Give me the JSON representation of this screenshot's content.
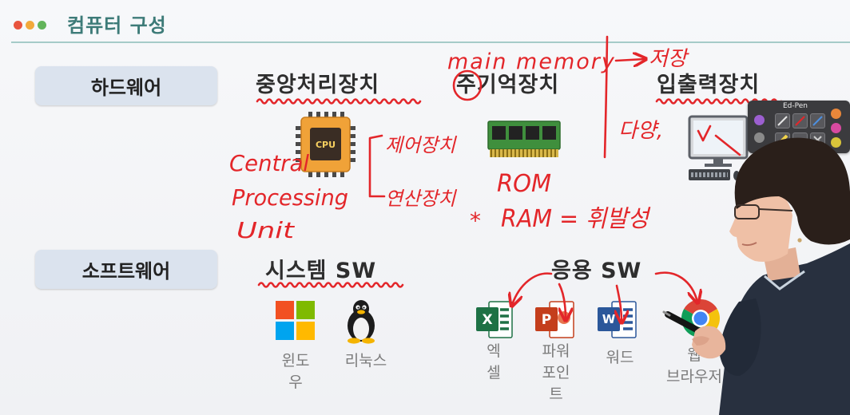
{
  "header": {
    "title": "컴퓨터 구성",
    "dot_colors": [
      "#e8543e",
      "#f2a93b",
      "#62b45a"
    ],
    "accent_color": "#3d7b78"
  },
  "rows": {
    "hardware": "하드웨어",
    "software": "소프트웨어"
  },
  "hardware": {
    "cpu": {
      "heading": "중앙처리장치",
      "icon": "cpu-chip-icon",
      "chip_text": "CPU"
    },
    "main_memory": {
      "heading": "주기억장치",
      "icon": "ram-module-icon"
    },
    "io": {
      "heading": "입출력장치",
      "icon": "computer-monitor-icon"
    }
  },
  "software": {
    "system": {
      "heading": "시스템 SW",
      "apps": [
        {
          "label": "윈도우",
          "icon": "windows-logo-icon"
        },
        {
          "label": "리눅스",
          "icon": "linux-tux-icon"
        }
      ]
    },
    "application": {
      "heading": "응용 SW",
      "apps": [
        {
          "label": "엑셀",
          "icon": "excel-icon",
          "glyph": "X"
        },
        {
          "label": "파워포인트",
          "icon": "powerpoint-icon",
          "glyph": "P"
        },
        {
          "label": "워드",
          "icon": "word-icon",
          "glyph": "W"
        },
        {
          "label": "웹 브라우저",
          "icon": "chrome-icon"
        }
      ]
    }
  },
  "annotations": {
    "ink_color": "#e3262a",
    "main_memory": "main memory",
    "storage": "저장",
    "variety": "다양,",
    "control_unit": "제어장치",
    "arithmetic_unit": "연산장치",
    "cpu_expansion": [
      "Central",
      "Processing",
      "Unit"
    ],
    "rom": "ROM",
    "ram": "RAM = 휘발성",
    "star": "*"
  },
  "pen_palette": {
    "title": "Ed-Pen"
  }
}
